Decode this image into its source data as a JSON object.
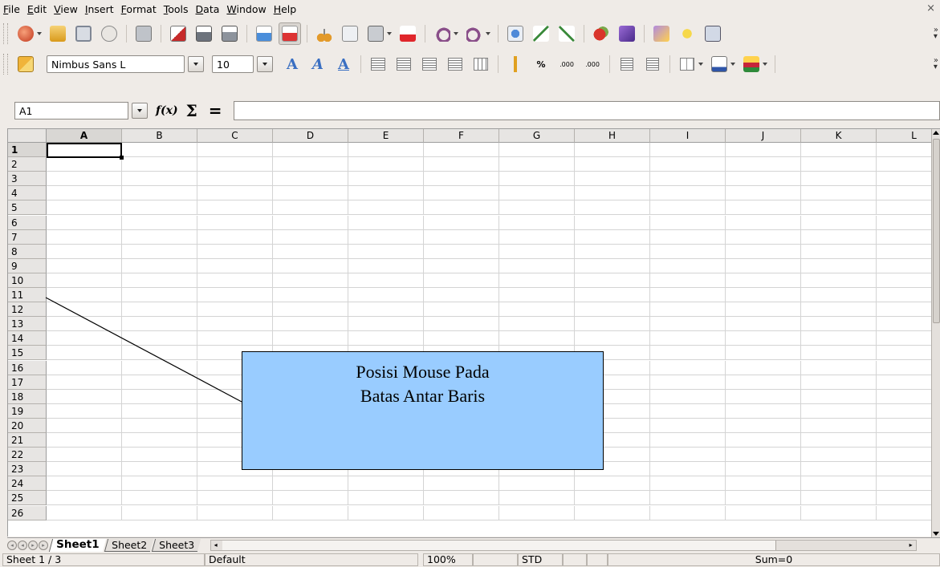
{
  "menu": [
    "File",
    "Edit",
    "View",
    "Insert",
    "Format",
    "Tools",
    "Data",
    "Window",
    "Help"
  ],
  "window": {
    "close_glyph": "×"
  },
  "toolbar_standard": {
    "icons": [
      "new-document-icon",
      "open-icon",
      "save-icon",
      "email-icon",
      "edit-file-icon",
      "export-pdf-icon",
      "print-icon",
      "page-preview-icon",
      "spellcheck-icon",
      "autospellcheck-icon",
      "cut-icon",
      "copy-icon",
      "paste-icon",
      "format-paintbrush-icon",
      "undo-icon",
      "redo-icon",
      "hyperlink-icon",
      "sort-ascending-icon",
      "sort-descending-icon",
      "chart-icon",
      "draw-functions-icon",
      "navigator-icon",
      "gallery-icon",
      "datasources-icon"
    ]
  },
  "toolbar_formatting": {
    "font_name": "Nimbus Sans L",
    "font_size": "10",
    "percent_label": "%",
    "add_decimal_label": ".000",
    "del_decimal_label": ".000"
  },
  "formula_bar": {
    "name_box": "A1",
    "fx_label": "f(x)",
    "sum_label": "Σ",
    "equals_label": "=",
    "input_value": ""
  },
  "grid": {
    "columns": [
      "A",
      "B",
      "C",
      "D",
      "E",
      "F",
      "G",
      "H",
      "I",
      "J",
      "K",
      "L"
    ],
    "rows": [
      "1",
      "2",
      "3",
      "4",
      "5",
      "6",
      "7",
      "8",
      "9",
      "10",
      "11",
      "12",
      "13",
      "14",
      "15",
      "16",
      "17",
      "18",
      "19",
      "20",
      "21",
      "22",
      "23",
      "24",
      "25",
      "26"
    ],
    "active_cell": "A1"
  },
  "callout": {
    "line1": "Posisi Mouse Pada",
    "line2": "Batas Antar Baris"
  },
  "sheet_tabs": [
    "Sheet1",
    "Sheet2",
    "Sheet3"
  ],
  "statusbar": {
    "sheet": "Sheet 1 / 3",
    "style": "Default",
    "zoom": "100%",
    "mode": "STD",
    "sum": "Sum=0"
  },
  "colors": {
    "callout_fill": "#99ccff",
    "chrome_bg": "#efebe7"
  }
}
